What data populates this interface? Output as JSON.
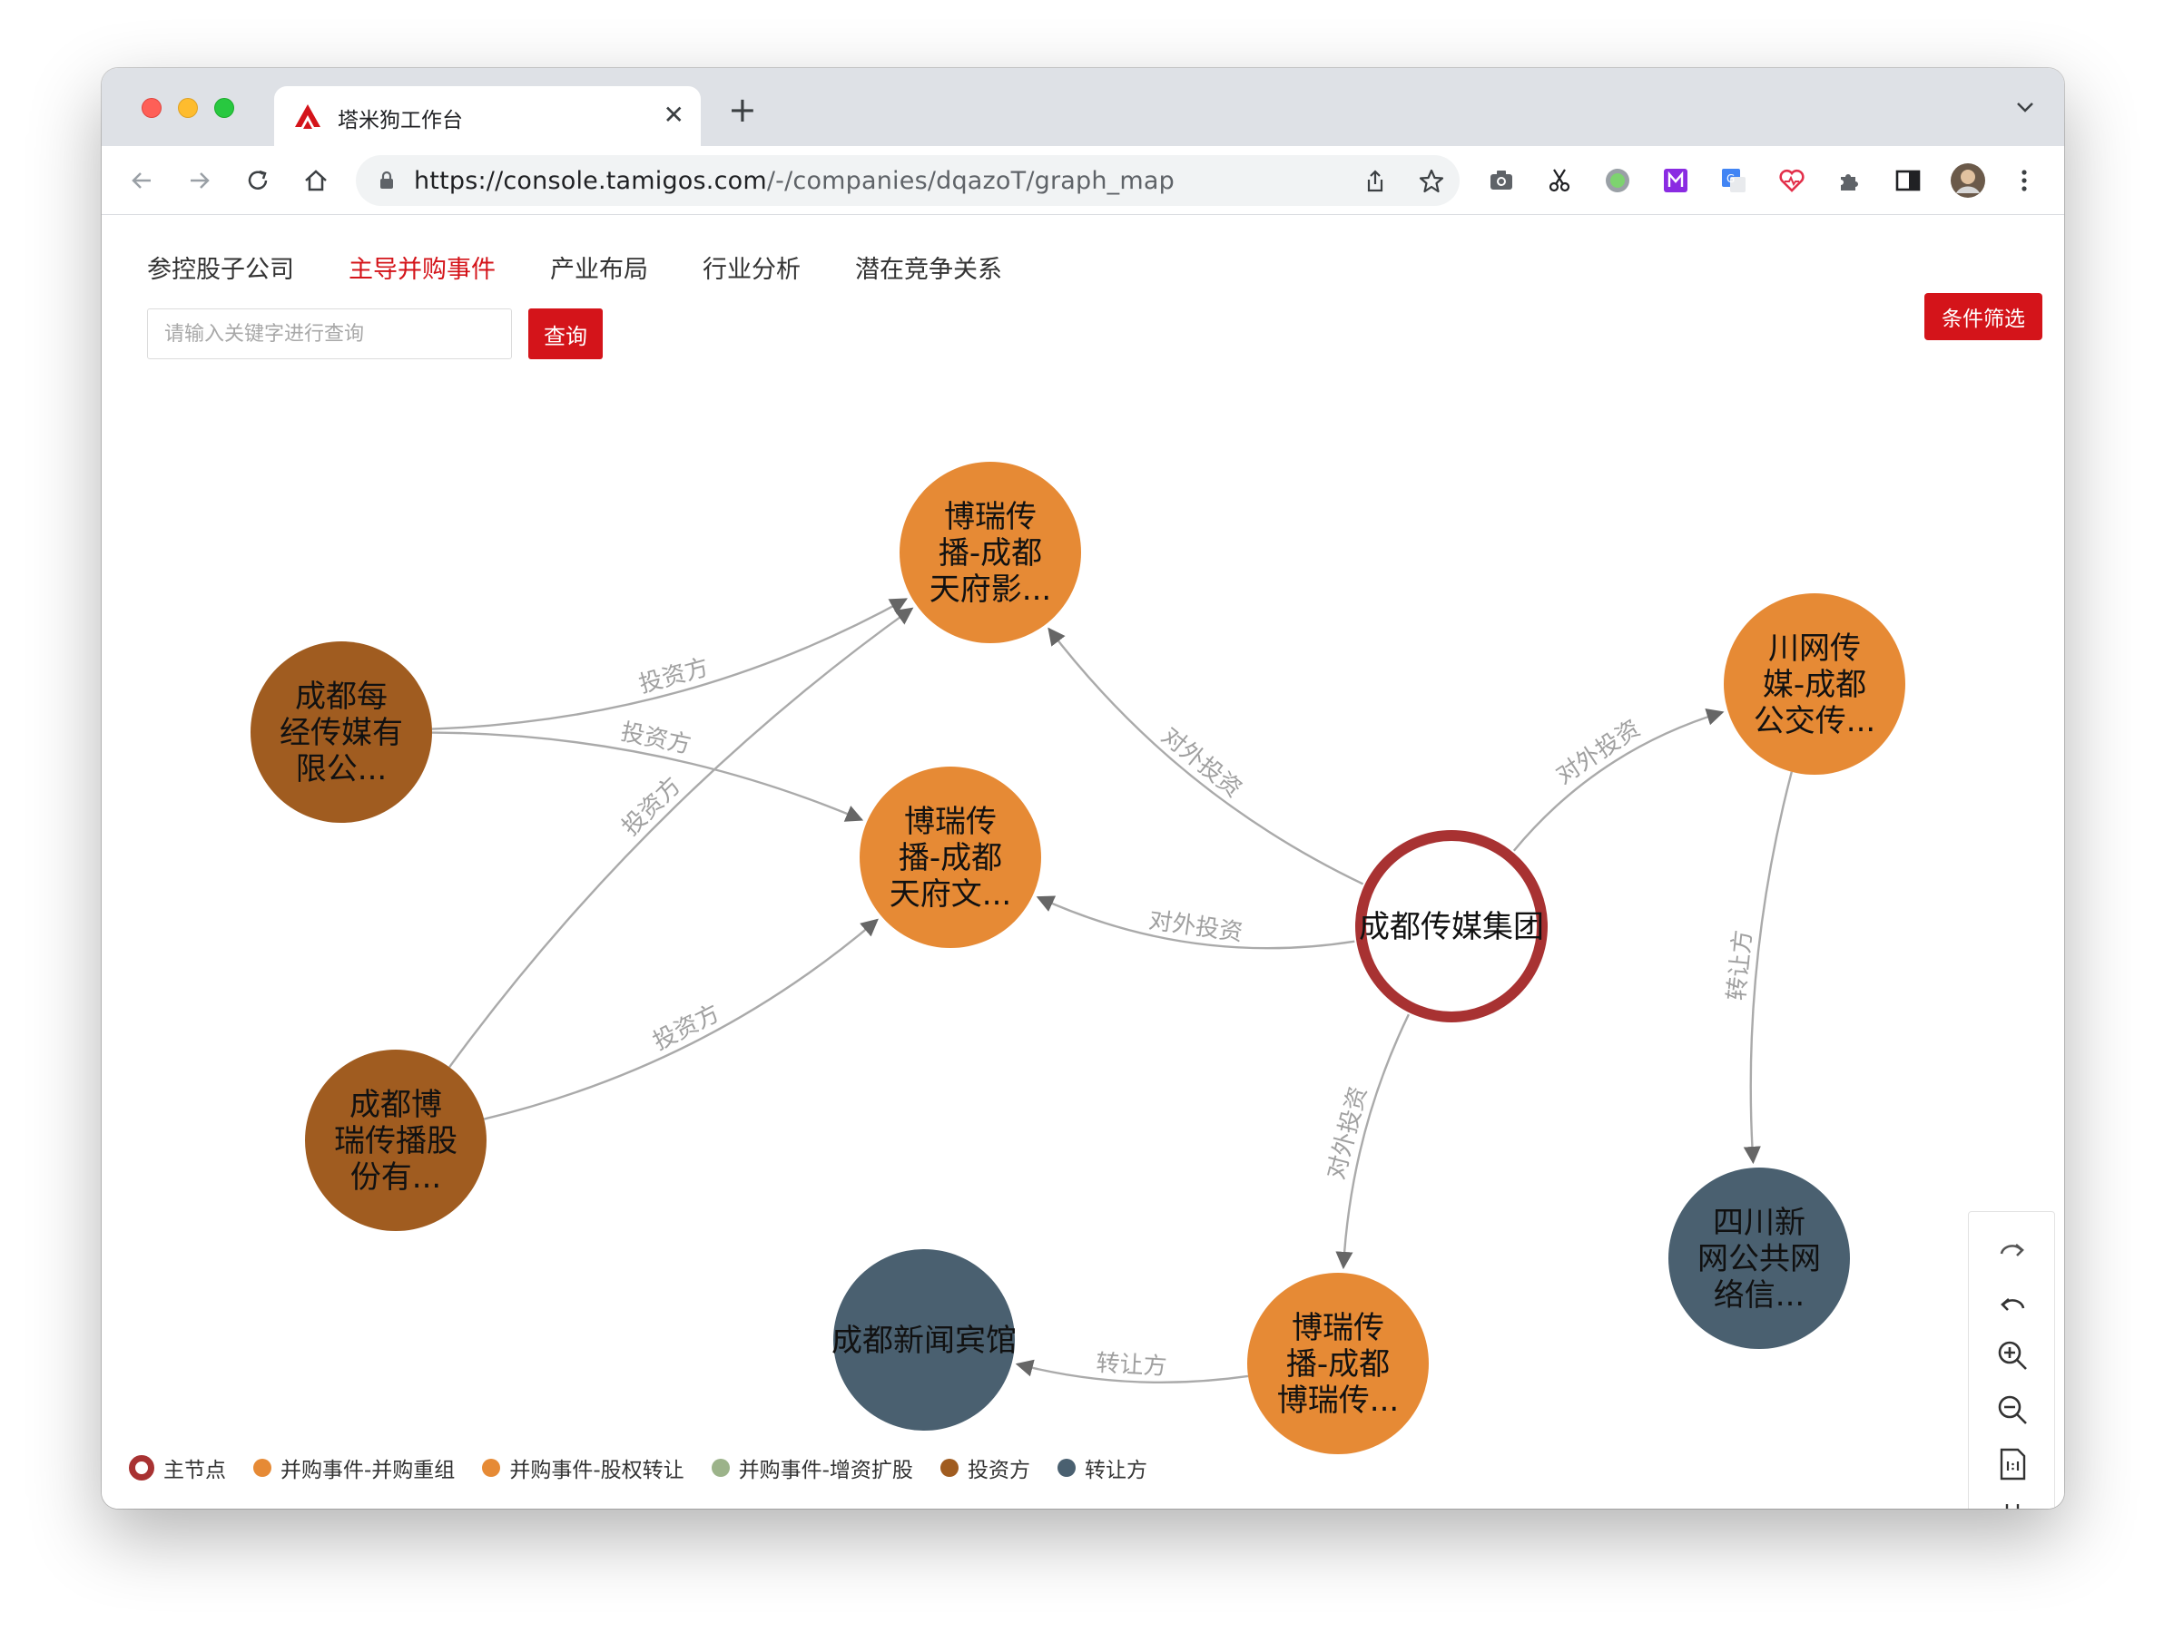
{
  "browser": {
    "tab_title": "塔米狗工作台",
    "url_host": "https://console.tamigos.com",
    "url_path": "/-/companies/dqazoT/graph_map"
  },
  "subnav": {
    "items": [
      "参控股子公司",
      "主导并购事件",
      "产业布局",
      "行业分析",
      "潜在竞争关系"
    ],
    "active_index": 1
  },
  "search": {
    "placeholder": "请输入关键字进行查询",
    "button_label": "查询"
  },
  "filter_button_label": "条件筛选",
  "colors": {
    "main": "#a83232",
    "merger_restructure": "#e68a35",
    "equity_transfer": "#e68a35",
    "capital_increase": "#9cb38a",
    "investor": "#a05c20",
    "transferor": "#4a6070",
    "accent": "#d4141a"
  },
  "graph": {
    "nodes": [
      {
        "id": "main",
        "label": "成都传媒集团",
        "type": "main",
        "lines": [
          "成都传媒集团"
        ]
      },
      {
        "id": "b1",
        "label": "博瑞传播-成都天府影...",
        "type": "equity_transfer",
        "lines": [
          "博瑞传",
          "播-成都",
          "天府影..."
        ]
      },
      {
        "id": "b2",
        "label": "博瑞传播-成都天府文...",
        "type": "equity_transfer",
        "lines": [
          "博瑞传",
          "播-成都",
          "天府文..."
        ]
      },
      {
        "id": "cw",
        "label": "川网传媒-成都公交传...",
        "type": "equity_transfer",
        "lines": [
          "川网传",
          "媒-成都",
          "公交传..."
        ]
      },
      {
        "id": "mj",
        "label": "成都每经传媒有限公...",
        "type": "investor",
        "lines": [
          "成都每",
          "经传媒有",
          "限公..."
        ]
      },
      {
        "id": "br",
        "label": "成都博瑞传播股份有...",
        "type": "investor",
        "lines": [
          "成都博",
          "瑞传播股",
          "份有..."
        ]
      },
      {
        "id": "sc",
        "label": "四川新网公共网络信...",
        "type": "transferor",
        "lines": [
          "四川新",
          "网公共网",
          "络信..."
        ]
      },
      {
        "id": "bg",
        "label": "成都新闻宾馆",
        "type": "transferor",
        "lines": [
          "成都新闻宾馆"
        ]
      },
      {
        "id": "b3",
        "label": "博瑞传播-成都博瑞传...",
        "type": "equity_transfer",
        "lines": [
          "博瑞传",
          "播-成都",
          "博瑞传..."
        ]
      }
    ],
    "edges": [
      {
        "from": "mj",
        "to": "b1",
        "label": "投资方"
      },
      {
        "from": "mj",
        "to": "b2",
        "label": "投资方"
      },
      {
        "from": "br",
        "to": "b1",
        "label": "投资方"
      },
      {
        "from": "br",
        "to": "b2",
        "label": "投资方"
      },
      {
        "from": "main",
        "to": "b1",
        "label": "对外投资"
      },
      {
        "from": "main",
        "to": "b2",
        "label": "对外投资"
      },
      {
        "from": "main",
        "to": "cw",
        "label": "对外投资"
      },
      {
        "from": "main",
        "to": "b3",
        "label": "对外投资"
      },
      {
        "from": "cw",
        "to": "sc",
        "label": "转让方"
      },
      {
        "from": "b3",
        "to": "bg",
        "label": "转让方"
      }
    ]
  },
  "zoom_controls": [
    "redo-icon",
    "undo-icon",
    "zoom-in-icon",
    "zoom-out-icon",
    "actual-size-icon",
    "fit-view-icon"
  ],
  "legend": [
    {
      "label": "主节点",
      "type": "main"
    },
    {
      "label": "并购事件-并购重组",
      "type": "merger_restructure"
    },
    {
      "label": "并购事件-股权转让",
      "type": "equity_transfer"
    },
    {
      "label": "并购事件-增资扩股",
      "type": "capital_increase"
    },
    {
      "label": "投资方",
      "type": "investor"
    },
    {
      "label": "转让方",
      "type": "transferor"
    }
  ]
}
